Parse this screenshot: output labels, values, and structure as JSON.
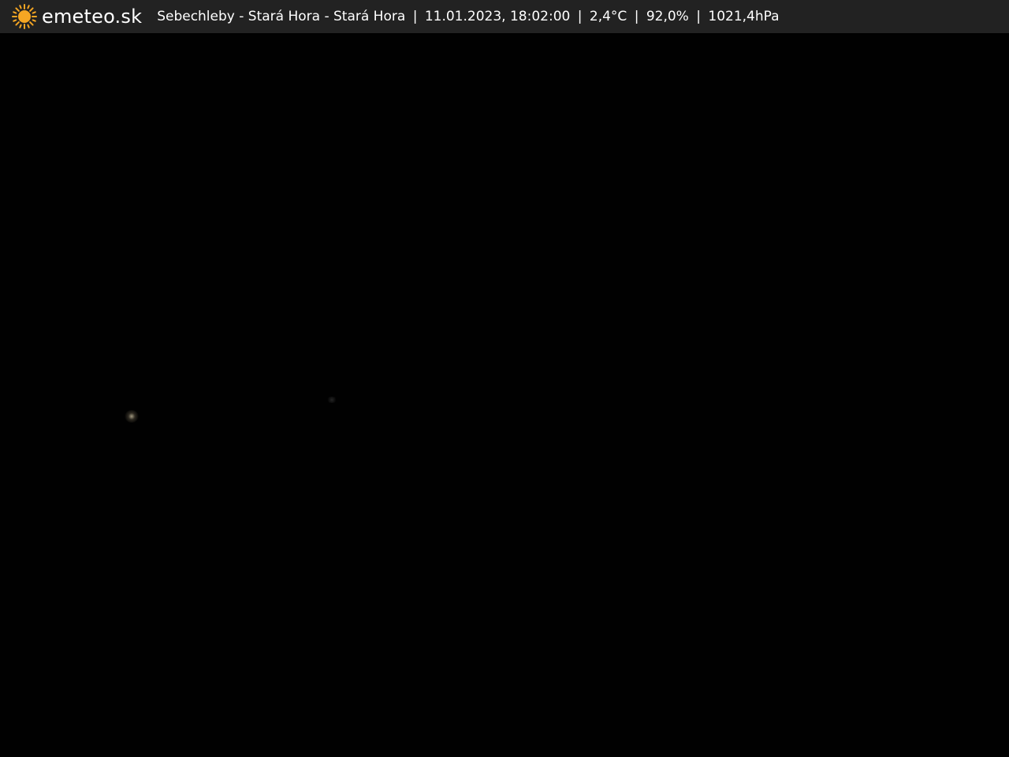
{
  "header": {
    "logo_icon": "sun-icon",
    "brand": "emeteo.sk",
    "location": "Sebechleby - Stará Hora - Stará Hora",
    "datetime": "11.01.2023, 18:02:00",
    "temperature": "2,4°C",
    "humidity": "92,0%",
    "pressure": "1021,4hPa",
    "separator": "|"
  },
  "colors": {
    "bar_background": "#222222",
    "sun": "#f5a623",
    "text": "#ffffff",
    "scene": "#010101"
  }
}
